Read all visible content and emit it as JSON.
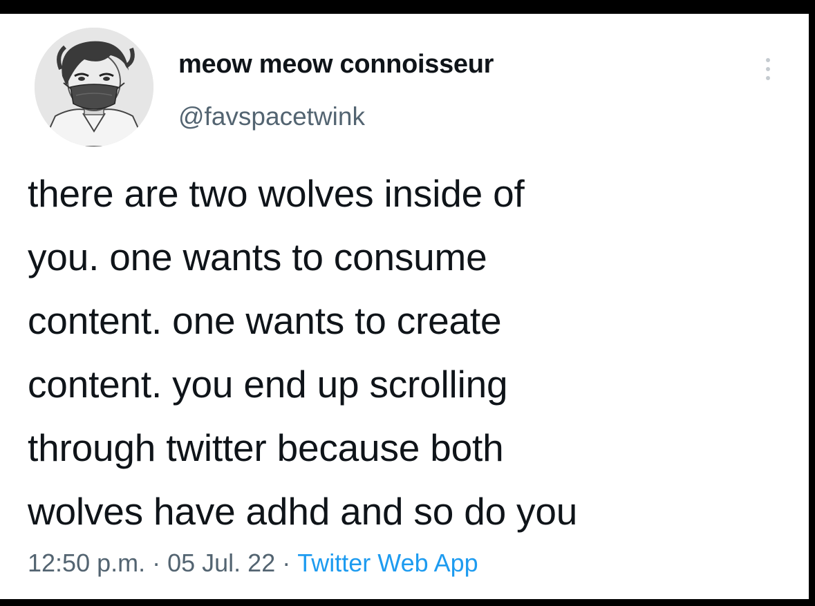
{
  "author": {
    "display_name": "meow meow connoisseur",
    "handle": "@favspacetwink",
    "avatar_icon": "anime-masked-boy-avatar-icon"
  },
  "more_icon": "more-vertical-icon",
  "tweet": {
    "lines": [
      "there are two wolves inside of",
      "you. one wants to consume",
      "content. one wants to create",
      "content. you end up scrolling",
      "through twitter because both",
      "wolves have adhd and so do you"
    ]
  },
  "meta": {
    "time": "12:50 p.m.",
    "date": "05 Jul. 22",
    "separator": "·",
    "source": "Twitter Web App"
  },
  "colors": {
    "text_primary": "#0f1419",
    "text_secondary": "#536471",
    "link": "#1d9bf0",
    "background": "#ffffff",
    "frame": "#000000"
  }
}
